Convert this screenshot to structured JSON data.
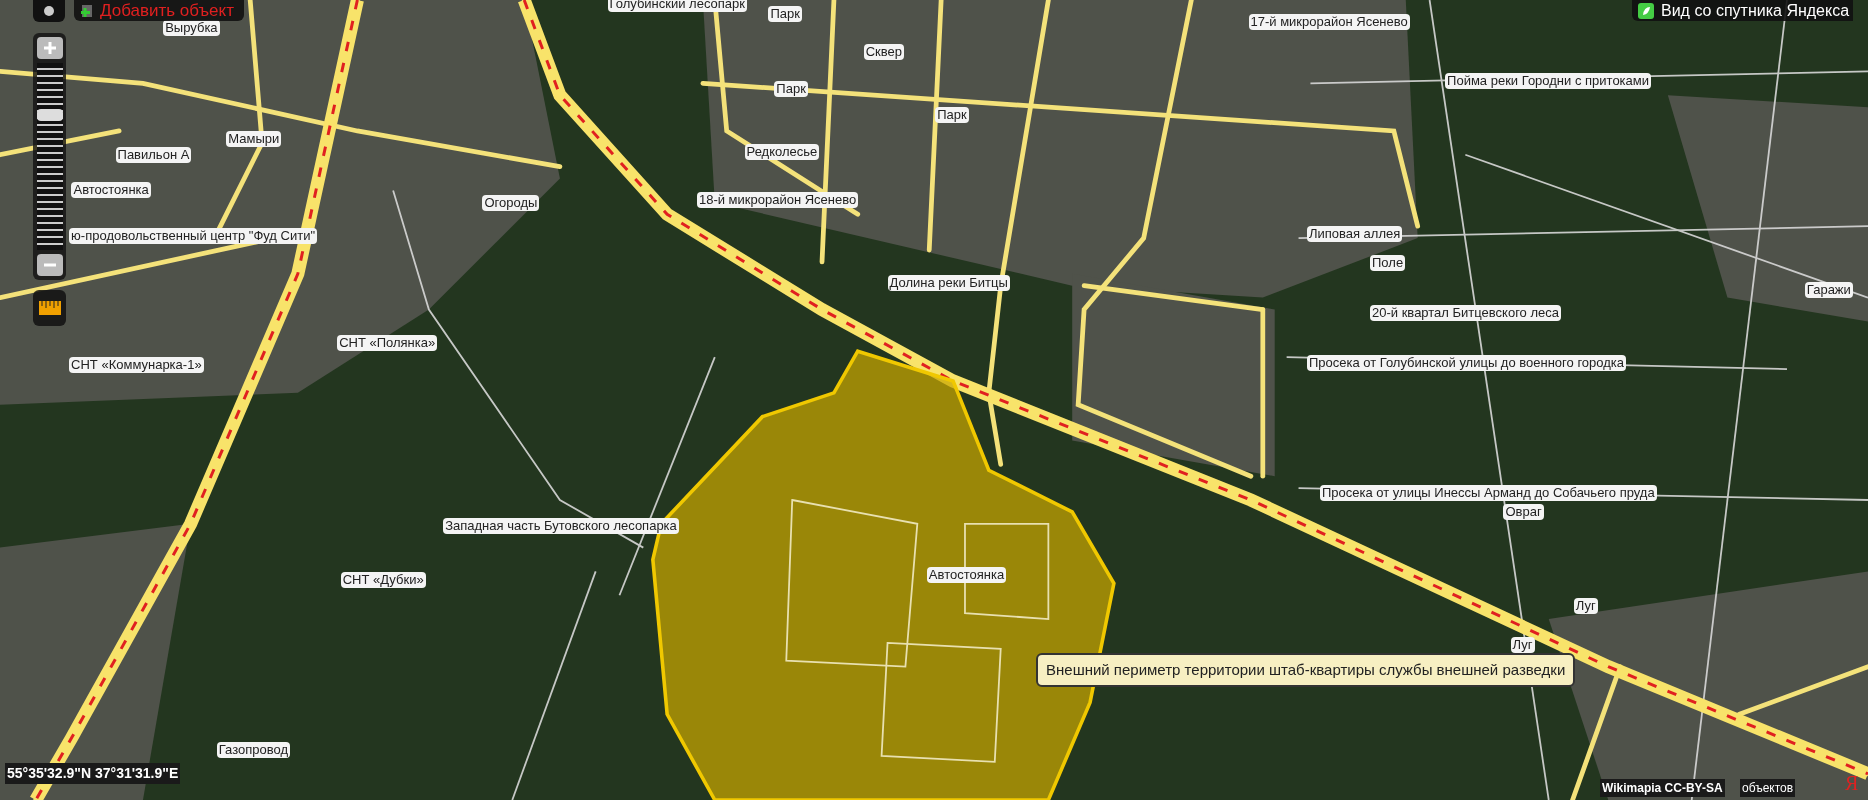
{
  "toolbar": {
    "add_object": "Добавить объект",
    "satellite_view": "Вид со спутника Яндекса"
  },
  "zoom": {
    "level": 0.72
  },
  "map_labels": [
    "Голубинский лесопарк",
    "Вырубка",
    "Парк",
    "Сквер",
    "Парк",
    "Парк",
    "17-й микрорайон Ясенево",
    "Пойма реки Городни с притоками",
    "Мамыри",
    "Павильон А",
    "Автостоянка",
    "ю-продовольственный центр \"Фуд Сити\"",
    "Редколесье",
    "Огороды",
    "18-й микрорайон Ясенево",
    "Липовая аллея",
    "Поле",
    "Гаражи",
    "20-й квартал Битцевского леса",
    "Долина реки Битцы",
    "СНТ «Полянка»",
    "СНТ «Коммунарка-1»",
    "Просека от Голубинской улицы до военного городка",
    "Просека от улицы Инессы Арманд до Собачьего пруда",
    "Овраг",
    "Западная часть Бутовского лесопарка",
    "Автостоянка",
    "СНТ «Дубки»",
    "Луг",
    "Луг",
    "Газопровод"
  ],
  "tooltip": "Внешний периметр территории штаб-квартиры службы внешней разведки",
  "coordinates": "55°35'32.9\"N 37°31'31.9\"E",
  "footer": {
    "license": "Wikimapia CC-BY-SA",
    "objects": "объектов",
    "logo": "Я"
  }
}
